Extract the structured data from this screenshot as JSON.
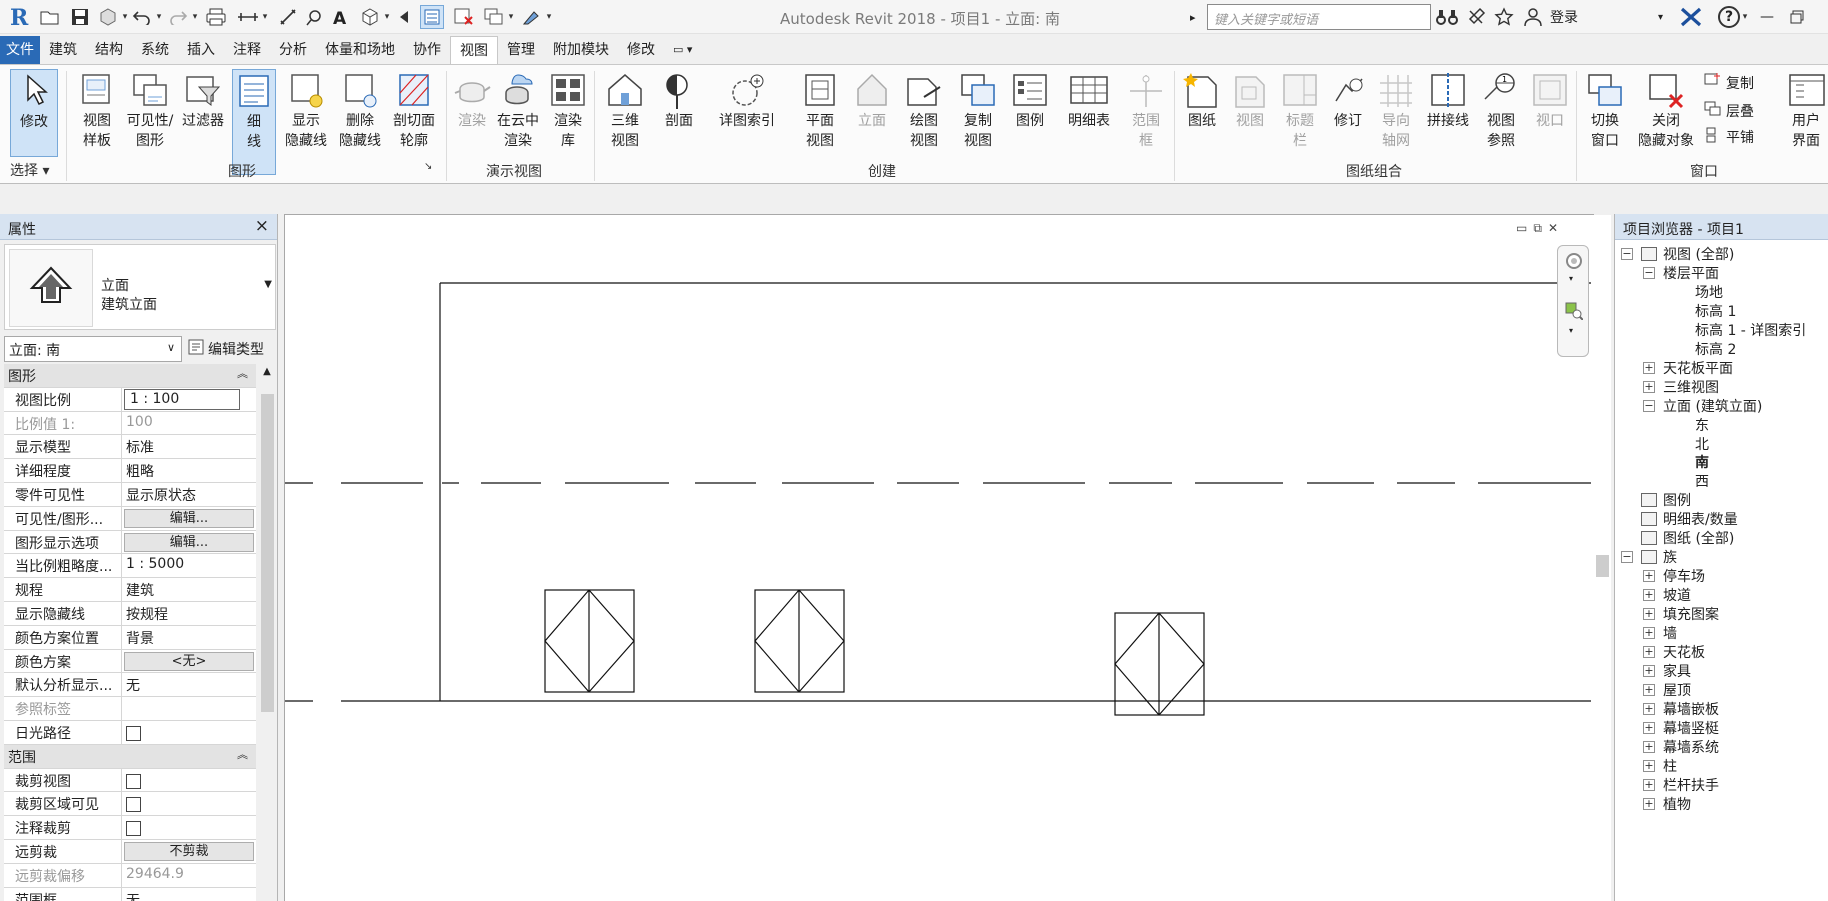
{
  "app": {
    "window_title": "Autodesk Revit 2018 -     项目1 - 立面: 南",
    "search_placeholder": "键入关键字或短语",
    "login_label": "登录",
    "help_label": "?"
  },
  "tabs": [
    {
      "label": "文件"
    },
    {
      "label": "建筑"
    },
    {
      "label": "结构"
    },
    {
      "label": "系统"
    },
    {
      "label": "插入"
    },
    {
      "label": "注释"
    },
    {
      "label": "分析"
    },
    {
      "label": "体量和场地"
    },
    {
      "label": "协作"
    },
    {
      "label": "视图"
    },
    {
      "label": "管理"
    },
    {
      "label": "附加模块"
    },
    {
      "label": "修改"
    }
  ],
  "ribbon": {
    "panels": {
      "select": "选择",
      "graphics": "图形",
      "presentation": "演示视图",
      "create": "创建",
      "sheet": "图纸组合",
      "window": "窗口"
    },
    "buttons": {
      "modify": "修改",
      "view_template_1": "视图",
      "view_template_2": "样板",
      "visibility_1": "可见性/",
      "visibility_2": "图形",
      "filters": "过滤器",
      "thin_1": "细",
      "thin_2": "线",
      "show_hidden_1": "显示",
      "show_hidden_2": "隐藏线",
      "remove_hidden_1": "删除",
      "remove_hidden_2": "隐藏线",
      "cut_profile_1": "剖切面",
      "cut_profile_2": "轮廓",
      "render": "渲染",
      "cloud_render_1": "在云中",
      "cloud_render_2": "渲染",
      "render_gallery_1": "渲染",
      "render_gallery_2": "库",
      "view3d_1": "三维",
      "view3d_2": "视图",
      "section": "剖面",
      "callout": "详图索引",
      "plan_1": "平面",
      "plan_2": "视图",
      "elevation": "立面",
      "drafting_1": "绘图",
      "drafting_2": "视图",
      "duplicate_1": "复制",
      "duplicate_2": "视图",
      "legend": "图例",
      "schedule": "明细表",
      "scope_1": "范围",
      "scope_2": "框",
      "sheet": "图纸",
      "view": "视图",
      "titleblock_1": "标题",
      "titleblock_2": "栏",
      "revision": "修订",
      "guide_1": "导向",
      "guide_2": "轴网",
      "matchline": "拼接线",
      "view_ref_1": "视图",
      "view_ref_2": "参照",
      "viewport": "视口",
      "switch_1": "切换",
      "switch_2": "窗口",
      "close_hidden_1": "关闭",
      "close_hidden_2": "隐藏对象",
      "replicate": "复制",
      "cascade": "层叠",
      "tile": "平铺",
      "user_1": "用户",
      "user_2": "界面"
    }
  },
  "properties": {
    "title": "属性",
    "close": "×",
    "type_name": "立面",
    "type_sub": "建筑立面",
    "instance_selector": "立面: 南",
    "edit_type": "编辑类型",
    "rows": [
      {
        "kind": "cat",
        "label": "图形"
      },
      {
        "kind": "input",
        "key": "视图比例",
        "value": "1 : 100"
      },
      {
        "kind": "dis",
        "key": "比例值 1:",
        "value": "100"
      },
      {
        "kind": "text",
        "key": "显示模型",
        "value": "标准"
      },
      {
        "kind": "text",
        "key": "详细程度",
        "value": "粗略"
      },
      {
        "kind": "text",
        "key": "零件可见性",
        "value": "显示原状态"
      },
      {
        "kind": "button",
        "key": "可见性/图形...",
        "value": "编辑..."
      },
      {
        "kind": "button",
        "key": "图形显示选项",
        "value": "编辑..."
      },
      {
        "kind": "text",
        "key": "当比例粗略度...",
        "value": "1 : 5000"
      },
      {
        "kind": "text",
        "key": "规程",
        "value": "建筑"
      },
      {
        "kind": "text",
        "key": "显示隐藏线",
        "value": "按规程"
      },
      {
        "kind": "text",
        "key": "颜色方案位置",
        "value": "背景"
      },
      {
        "kind": "button",
        "key": "颜色方案",
        "value": "<无>"
      },
      {
        "kind": "text",
        "key": "默认分析显示...",
        "value": "无"
      },
      {
        "kind": "dis",
        "key": "参照标签",
        "value": ""
      },
      {
        "kind": "check",
        "key": "日光路径",
        "value": ""
      },
      {
        "kind": "cat",
        "label": "范围"
      },
      {
        "kind": "check",
        "key": "裁剪视图",
        "value": ""
      },
      {
        "kind": "check",
        "key": "裁剪区域可见",
        "value": ""
      },
      {
        "kind": "check",
        "key": "注释裁剪",
        "value": ""
      },
      {
        "kind": "button",
        "key": "远剪裁",
        "value": "不剪裁"
      },
      {
        "kind": "dis",
        "key": "远剪裁偏移",
        "value": "29464.9"
      },
      {
        "kind": "text",
        "key": "范围框",
        "value": "无"
      }
    ]
  },
  "browser": {
    "title": "项目浏览器 - 项目1",
    "nodes": [
      {
        "label": "视图 (全部)",
        "level": 0,
        "box": "−",
        "icon": true
      },
      {
        "label": "楼层平面",
        "level": 1,
        "box": "−"
      },
      {
        "label": "场地",
        "level": 2
      },
      {
        "label": "标高 1",
        "level": 2
      },
      {
        "label": "标高 1 - 详图索引",
        "level": 2
      },
      {
        "label": "标高 2",
        "level": 2
      },
      {
        "label": "天花板平面",
        "level": 1,
        "box": "+"
      },
      {
        "label": "三维视图",
        "level": 1,
        "box": "+"
      },
      {
        "label": "立面 (建筑立面)",
        "level": 1,
        "box": "−"
      },
      {
        "label": "东",
        "level": 2
      },
      {
        "label": "北",
        "level": 2
      },
      {
        "label": "南",
        "level": 2,
        "bold": true
      },
      {
        "label": "西",
        "level": 2
      },
      {
        "label": "图例",
        "level": 0,
        "icon": true
      },
      {
        "label": "明细表/数量",
        "level": 0,
        "icon": true
      },
      {
        "label": "图纸 (全部)",
        "level": 0,
        "icon": true
      },
      {
        "label": "族",
        "level": 0,
        "box": "−",
        "icon": true
      },
      {
        "label": "停车场",
        "level": 1,
        "box": "+"
      },
      {
        "label": "坡道",
        "level": 1,
        "box": "+"
      },
      {
        "label": "填充图案",
        "level": 1,
        "box": "+"
      },
      {
        "label": "墙",
        "level": 1,
        "box": "+"
      },
      {
        "label": "天花板",
        "level": 1,
        "box": "+"
      },
      {
        "label": "家具",
        "level": 1,
        "box": "+"
      },
      {
        "label": "屋顶",
        "level": 1,
        "box": "+"
      },
      {
        "label": "幕墙嵌板",
        "level": 1,
        "box": "+"
      },
      {
        "label": "幕墙竖梃",
        "level": 1,
        "box": "+"
      },
      {
        "label": "幕墙系统",
        "level": 1,
        "box": "+"
      },
      {
        "label": "柱",
        "level": 1,
        "box": "+"
      },
      {
        "label": "栏杆扶手",
        "level": 1,
        "box": "+"
      },
      {
        "label": "植物",
        "level": 1,
        "box": "+"
      }
    ]
  },
  "colors": {
    "accent": "#2a6ab6",
    "panel_header": "#d7e3f1",
    "selected_button": "#cfe3f7"
  }
}
